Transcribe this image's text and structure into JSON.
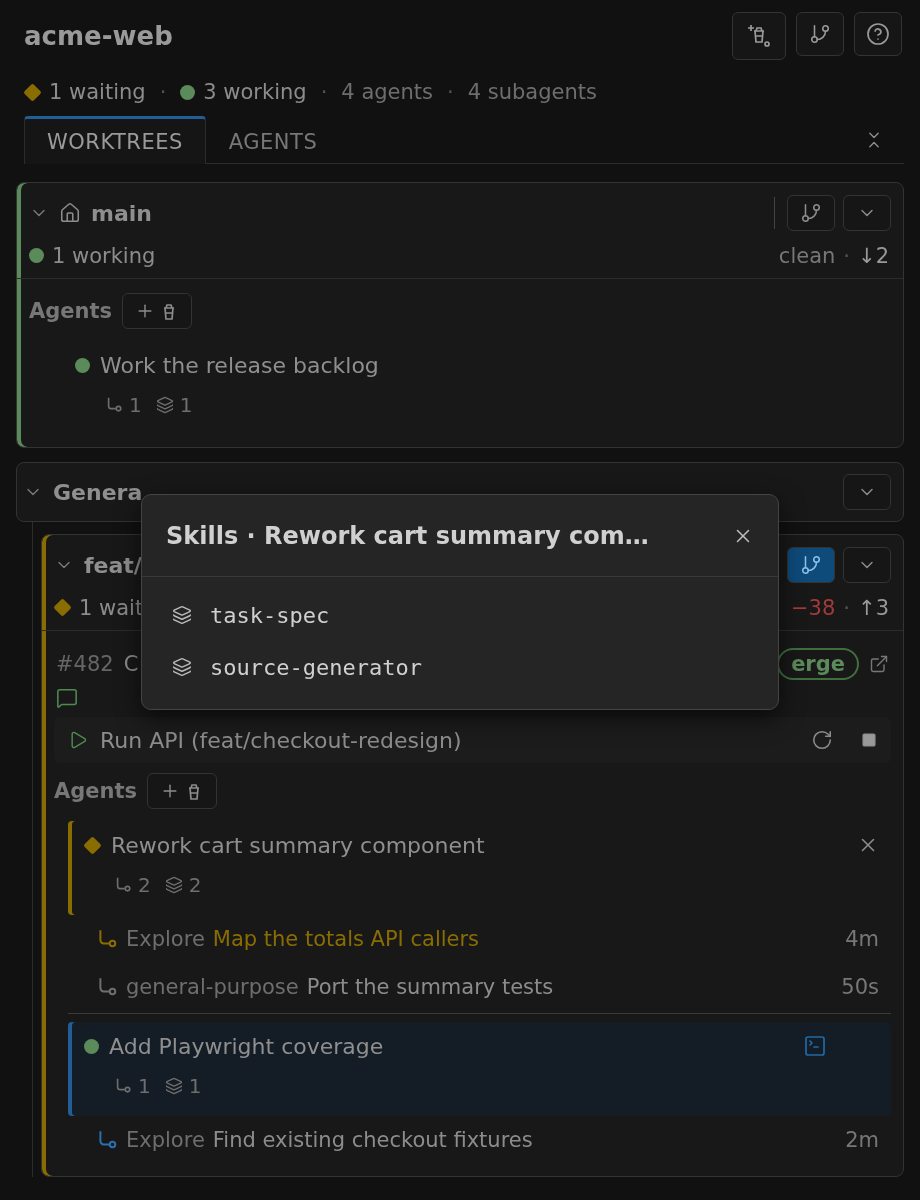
{
  "header": {
    "title": "acme-web",
    "separator": "·",
    "status": [
      {
        "kind": "waiting",
        "text": "1 waiting"
      },
      {
        "kind": "working",
        "text": "3 working"
      },
      {
        "kind": "plain",
        "text": "4 agents"
      },
      {
        "kind": "plain",
        "text": "4 subagents"
      }
    ]
  },
  "tabs": [
    {
      "label": "WORKTREES",
      "selected": true
    },
    {
      "label": "AGENTS",
      "selected": false
    }
  ],
  "worktrees": [
    {
      "kind": "worktree",
      "name": "main",
      "home": true,
      "branch_active": false,
      "status": {
        "kind": "working",
        "text": "1 working"
      },
      "separator": "·",
      "sync": [
        {
          "text": "clean",
          "color": "#777777"
        },
        {
          "text": "↓2",
          "color": "#999999"
        }
      ],
      "agents_label": "Agents",
      "agents": [
        {
          "title": "Work the release backlog",
          "kind": "working",
          "selected": false,
          "subagent_count": "1",
          "skill_count": "1"
        }
      ]
    },
    {
      "kind": "group",
      "name": "Genera",
      "children": [
        {
          "kind": "worktree",
          "name": "feat/",
          "home": false,
          "branch_active": true,
          "status": {
            "kind": "waiting",
            "text": "1 wait"
          },
          "separator": "·",
          "sync": [
            {
              "text": "−38",
              "color": "#a33a3a"
            },
            {
              "text": "↑3",
              "color": "#999999"
            }
          ],
          "pr": {
            "number": "#482",
            "title": "C",
            "badge": "erge"
          },
          "run": {
            "label": "Run API (feat/checkout-redesign)"
          },
          "agents_label": "Agents",
          "agents": [
            {
              "title": "Rework cart summary component",
              "kind": "waiting",
              "selected": false,
              "closable": true,
              "subagent_count": "2",
              "skill_count": "2",
              "subagents": [
                {
                  "type": "Explore",
                  "task": "Map the totals API callers",
                  "time": "4m",
                  "color": "#8a6d00",
                  "highlighted": true
                },
                {
                  "type": "general-purpose",
                  "task": "Port the summary tests",
                  "time": "50s",
                  "color": "#6e6e6e",
                  "highlighted": false
                }
              ]
            },
            {
              "title": "Add Playwright coverage",
              "kind": "working",
              "selected": true,
              "terminal": true,
              "subagent_count": "1",
              "skill_count": "1",
              "subagents": [
                {
                  "type": "Explore",
                  "task": "Find existing checkout fixtures",
                  "time": "2m",
                  "color": "#2a6fb0",
                  "highlighted": false
                }
              ]
            }
          ]
        }
      ]
    }
  ],
  "popup": {
    "title": "Skills · Rework cart summary com…",
    "items": [
      "task-spec",
      "source-generator"
    ]
  }
}
